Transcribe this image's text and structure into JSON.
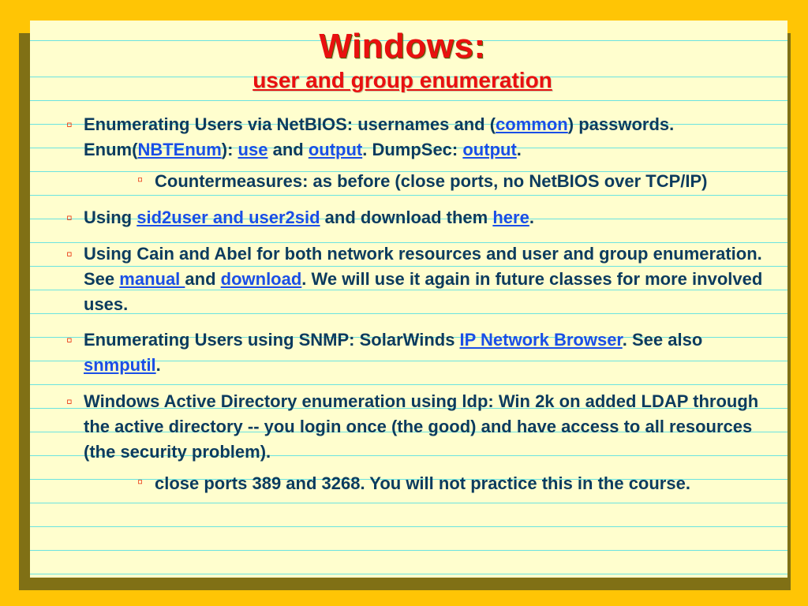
{
  "title": "Windows:",
  "subtitle": "user and group enumeration",
  "bullets": {
    "b1": {
      "t0": "Enumerating Users via NetBIOS:  usernames and (",
      "link_common": "common",
      "t1": ") passwords. Enum(",
      "link_nbtenum": "NBTEnum",
      "t2": "): ",
      "link_use": "use",
      "t3": " and ",
      "link_output1": "output",
      "t4": ". DumpSec: ",
      "link_output2": "output",
      "t5": ".",
      "sub": "Countermeasures: as before (close ports, no NetBIOS over TCP/IP)"
    },
    "b2": {
      "t0": "Using ",
      "link_sid": "sid2user and user2sid",
      "t1": " and download them  ",
      "link_here": "here",
      "t2": "."
    },
    "b3": {
      "t0": "Using Cain and Abel for both network resources and user and group enumeration. See ",
      "link_manual": "manual ",
      "t1": "and ",
      "link_download": "download",
      "t2": ".  We will use it again in future classes for more involved uses."
    },
    "b4": {
      "t0": "Enumerating Users using SNMP:  SolarWinds ",
      "link_ipnb": "IP Network Browser",
      "t1": ". See also ",
      "link_snmp": "snmputil",
      "t2": "."
    },
    "b5": {
      "t0": "Windows Active Directory enumeration using ldp: Win 2k  on added LDAP through the active directory -- you login once  (the good) and have access to all resources (the security problem).",
      "sub": "close ports 389 and 3268. You will not practice this in the course."
    }
  }
}
